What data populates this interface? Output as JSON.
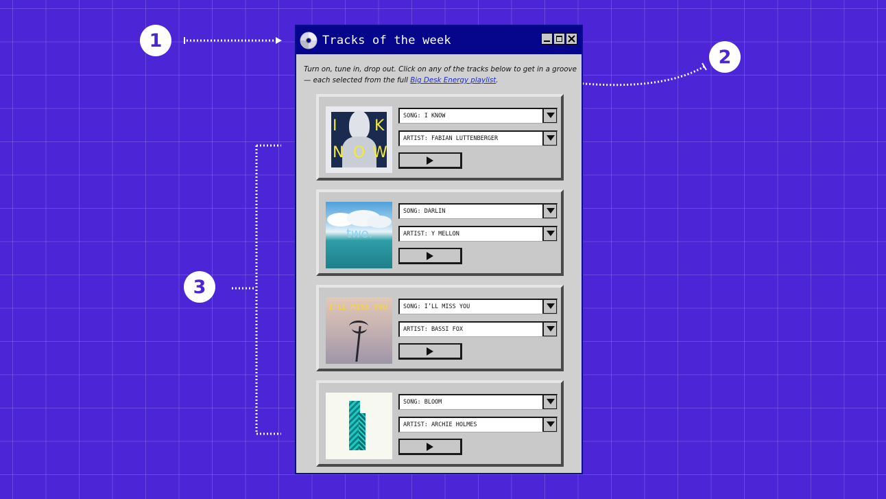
{
  "markers": [
    "1",
    "2",
    "3"
  ],
  "window": {
    "title": "Tracks of the week",
    "icon": "cd-icon",
    "controls": [
      "minimize-icon",
      "maximize-icon",
      "close-icon"
    ]
  },
  "intro": {
    "text": "Turn on, tune in, drop out. Click on any of the tracks below to get in a groove — each selected from the full ",
    "link": "Big Desk Energy playlist",
    "tail": "."
  },
  "tracks": [
    {
      "song": "SONG: I KNOW",
      "artist": "ARTIST: FABIAN LUTTENBERGER",
      "art_text": [
        "I",
        "K",
        "N",
        "O",
        "W"
      ],
      "art_color": "#1b2b4f",
      "art_text_color": "#f1ea3c"
    },
    {
      "song": "SONG: DARLIN",
      "artist": "ARTIST: Y MELLON",
      "art_text": "two.",
      "art_color": "#5fa6d8",
      "art_text_color": "#8bd3f5"
    },
    {
      "song": "SONG: I’LL MISS YOU",
      "artist": "ARTIST: BASSI FOX",
      "art_text": "I'LL MISS YOU",
      "art_color": "#b3a6ac",
      "art_text_color": "#f4d34a"
    },
    {
      "song": "SONG: BLOOM",
      "artist": "ARTIST: ARCHIE HOLMES",
      "art_text": "",
      "art_color": "#f7f8ef",
      "art_text_color": "#20c6b8"
    }
  ],
  "colors": {
    "background": "#4b25d6",
    "titlebar": "#06068c",
    "window": "#d0d0d0",
    "link": "#1b2bd8"
  }
}
